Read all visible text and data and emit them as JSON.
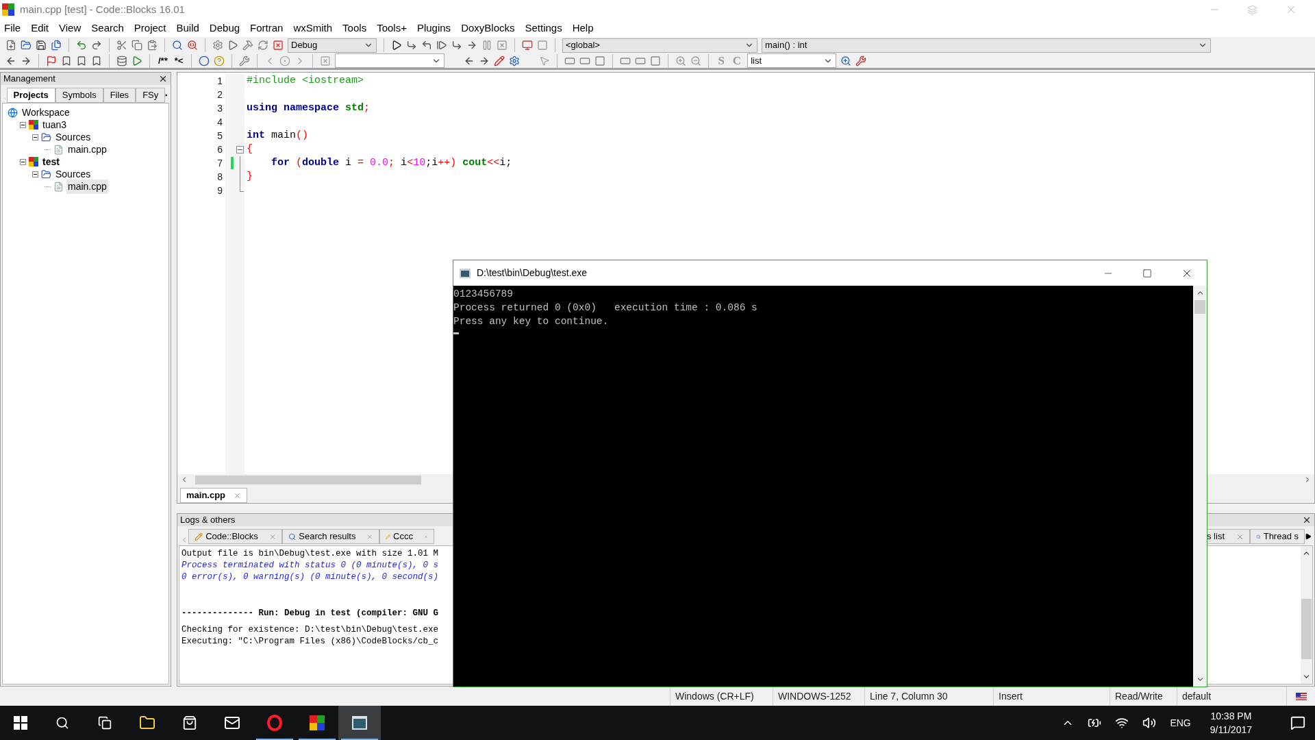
{
  "window": {
    "title": "main.cpp [test] - Code::Blocks 16.01"
  },
  "menu": [
    "File",
    "Edit",
    "View",
    "Search",
    "Project",
    "Build",
    "Debug",
    "Fortran",
    "wxSmith",
    "Tools",
    "Tools+",
    "Plugins",
    "DoxyBlocks",
    "Settings",
    "Help"
  ],
  "toolbar": {
    "build_target": "Debug",
    "scope": "<global>",
    "symbol": "main() : int",
    "comment_buttons": [
      "/**",
      "*<"
    ],
    "style_buttons": [
      "S",
      "C"
    ],
    "list_combo": "list"
  },
  "management": {
    "title": "Management",
    "tabs": [
      {
        "label": "Projects",
        "selected": true
      },
      {
        "label": "Symbols",
        "selected": false
      },
      {
        "label": "Files",
        "selected": false
      },
      {
        "label": "FSy",
        "selected": false
      }
    ],
    "tree": [
      {
        "label": "Workspace",
        "kind": "workspace",
        "children": [
          {
            "label": "tuan3",
            "kind": "project",
            "active": false,
            "expanded": true,
            "children": [
              {
                "label": "Sources",
                "kind": "folder",
                "expanded": true,
                "children": [
                  {
                    "label": "main.cpp",
                    "kind": "file",
                    "selected": false
                  }
                ]
              }
            ]
          },
          {
            "label": "test",
            "kind": "project",
            "active": true,
            "expanded": true,
            "children": [
              {
                "label": "Sources",
                "kind": "folder",
                "expanded": true,
                "children": [
                  {
                    "label": "main.cpp",
                    "kind": "file",
                    "selected": true
                  }
                ]
              }
            ]
          }
        ]
      }
    ]
  },
  "editor": {
    "lines": [
      {
        "number": "1",
        "changed": false,
        "kind": "plain",
        "tokens": [
          {
            "text": "#include <iostream>",
            "kind": "preprocessor"
          }
        ]
      },
      {
        "number": "2",
        "changed": false,
        "kind": "plain"
      },
      {
        "number": "3",
        "changed": false,
        "kind": "plain",
        "tokens": [
          {
            "text": "using",
            "kind": "keyword"
          },
          {
            "text": " namespace",
            "kind": "keyword"
          },
          {
            "text": " std",
            "kind": "library"
          },
          {
            "text": ";",
            "kind": "operator"
          }
        ]
      },
      {
        "number": "4",
        "changed": false,
        "kind": "plain"
      },
      {
        "number": "5",
        "changed": false,
        "kind": "plain",
        "tokens": [
          {
            "text": "int",
            "kind": "keyword"
          },
          {
            "text": " main",
            "kind": "plain"
          },
          {
            "text": "()",
            "kind": "operator"
          }
        ]
      },
      {
        "number": "6",
        "changed": false,
        "kind": "fold_start",
        "tokens": [
          {
            "text": "{",
            "kind": "operator"
          }
        ]
      },
      {
        "number": "7",
        "changed": true,
        "kind": "fold_body",
        "tokens": [
          {
            "text": "    for",
            "kind": "keyword"
          },
          {
            "text": " (",
            "kind": "operator"
          },
          {
            "text": "double",
            "kind": "keyword"
          },
          {
            "text": " i ",
            "kind": "plain"
          },
          {
            "text": "=",
            "kind": "operator"
          },
          {
            "text": " 0.0",
            "kind": "number"
          },
          {
            "text": ";",
            "kind": "operator"
          },
          {
            "text": " i",
            "kind": "plain"
          },
          {
            "text": "<",
            "kind": "operator"
          },
          {
            "text": "10",
            "kind": "number"
          },
          {
            "text": ";i",
            "kind": "plain"
          },
          {
            "text": "++)",
            "kind": "operator"
          },
          {
            "text": " cout",
            "kind": "library"
          },
          {
            "text": "<<",
            "kind": "operator"
          },
          {
            "text": "i;",
            "kind": "plain"
          }
        ]
      },
      {
        "number": "8",
        "changed": false,
        "kind": "fold_body",
        "tokens": [
          {
            "text": "}",
            "kind": "operator"
          }
        ]
      },
      {
        "number": "9",
        "changed": false,
        "kind": "fold_end"
      }
    ],
    "tabs": [
      {
        "label": "main.cpp",
        "selected": true
      }
    ]
  },
  "logs": {
    "title": "Logs & others",
    "tabs_left": [
      {
        "label": "Code::Blocks",
        "kind": "log",
        "selected": false
      },
      {
        "label": "Search results",
        "kind": "search",
        "selected": false
      },
      {
        "label": "Cccc",
        "kind": "log",
        "selected": false
      }
    ],
    "tabs_right": [
      {
        "label": "s list",
        "kind": "list",
        "selected": false
      },
      {
        "label": "Thread s",
        "kind": "search",
        "selected": false
      }
    ],
    "lines": [
      {
        "text": "Output file is bin\\Debug\\test.exe with size 1.01 M",
        "kind": "normal"
      },
      {
        "text": "Process terminated with status 0 (0 minute(s), 0 s",
        "kind": "status"
      },
      {
        "text": "0 error(s), 0 warning(s) (0 minute(s), 0 second(s)",
        "kind": "status"
      },
      {
        "text": "-------------- Run: Debug in test (compiler: GNU G",
        "kind": "heading"
      },
      {
        "text": "Checking for existence: D:\\test\\bin\\Debug\\test.exe",
        "kind": "normal"
      },
      {
        "text": "Executing: \"C:\\Program Files (x86)\\CodeBlocks/cb_c",
        "kind": "normal"
      }
    ]
  },
  "status_bar": [
    "Windows (CR+LF)",
    "WINDOWS-1252",
    "Line 7, Column 30",
    "Insert",
    "Read/Write",
    "default"
  ],
  "console": {
    "title": "D:\\test\\bin\\Debug\\test.exe",
    "lines": [
      "0123456789",
      "Process returned 0 (0x0)   execution time : 0.086 s",
      "Press any key to continue."
    ]
  },
  "taskbar": {
    "apps": [
      {
        "kind": "explorer",
        "running": false,
        "active": false
      },
      {
        "kind": "store",
        "running": false,
        "active": false
      },
      {
        "kind": "mail",
        "running": false,
        "active": false
      },
      {
        "kind": "browser",
        "running": true,
        "active": false
      },
      {
        "kind": "ide",
        "running": true,
        "active": false
      },
      {
        "kind": "console",
        "running": true,
        "active": true
      }
    ],
    "language": "ENG",
    "time": "10:38 PM",
    "date": "9/11/2017"
  }
}
